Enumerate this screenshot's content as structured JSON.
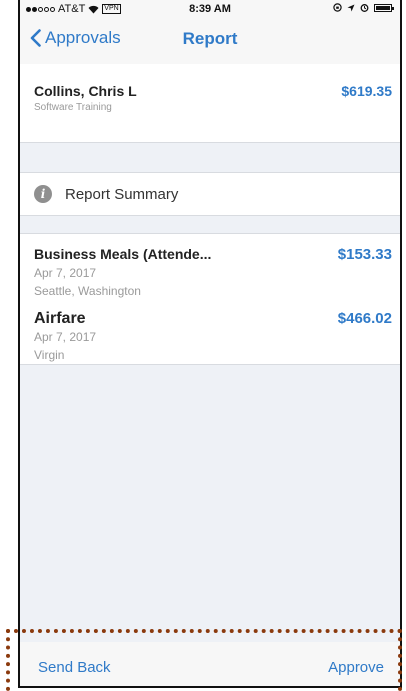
{
  "status_bar": {
    "carrier": "AT&T",
    "vpn": "VPN",
    "time": "8:39 AM",
    "wifi_icon": "wifi-icon",
    "location_icon": "location-icon",
    "alarm_icon": "alarm-icon"
  },
  "nav": {
    "back_label": "Approvals",
    "title": "Report"
  },
  "report": {
    "employee": "Collins, Chris L",
    "type": "Software Training",
    "total": "$619.35"
  },
  "summary": {
    "label": "Report Summary",
    "icon": "info-icon"
  },
  "items": [
    {
      "title": "Business Meals (Attende...",
      "date": "Apr 7, 2017",
      "location": "Seattle, Washington",
      "amount": "$153.33"
    },
    {
      "title": "Airfare",
      "date": "Apr 7, 2017",
      "location": "Virgin",
      "amount": "$466.02"
    }
  ],
  "toolbar": {
    "send_back": "Send Back",
    "approve": "Approve"
  },
  "colors": {
    "accent": "#2f7ac8",
    "highlight": "#8b3a0e",
    "background": "#eef1f6"
  }
}
